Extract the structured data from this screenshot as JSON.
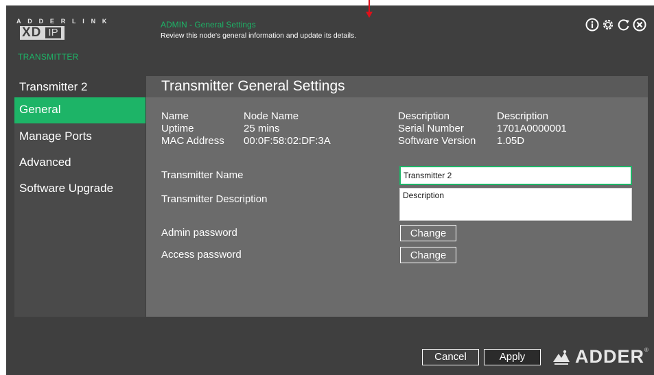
{
  "brand": {
    "letters": "ADDERLINK",
    "product_xd": "XD",
    "product_ip": "IP",
    "role": "TRANSMITTER"
  },
  "header": {
    "title": "ADMIN - General Settings",
    "subtitle": "Review this node's general information and update its details.",
    "icons": [
      "info-icon",
      "settings-gear-icon",
      "refresh-icon",
      "close-icon"
    ]
  },
  "sidebar": {
    "node_name": "Transmitter 2",
    "items": [
      {
        "label": "General",
        "active": true
      },
      {
        "label": "Manage Ports",
        "active": false
      },
      {
        "label": "Advanced",
        "active": false
      },
      {
        "label": "Software Upgrade",
        "active": false
      }
    ]
  },
  "main": {
    "title": "Transmitter General Settings",
    "info_left": [
      {
        "label": "Name",
        "value": "Node Name"
      },
      {
        "label": "Uptime",
        "value": "25 mins"
      },
      {
        "label": "MAC Address",
        "value": "00:0F:58:02:DF:3A"
      }
    ],
    "info_right": [
      {
        "label": "Description",
        "value": "Description"
      },
      {
        "label": "Serial Number",
        "value": "1701A0000001"
      },
      {
        "label": "Software Version",
        "value": "1.05D"
      }
    ],
    "fields": {
      "name_label": "Transmitter Name",
      "name_value": "Transmitter 2",
      "description_label": "Transmitter Description",
      "description_value": "Description",
      "admin_password_label": "Admin password",
      "access_password_label": "Access password",
      "change_label": "Change"
    }
  },
  "footer": {
    "cancel_label": "Cancel",
    "apply_label": "Apply",
    "logo_text": "ADDER",
    "logo_reg": "®"
  },
  "colors": {
    "accent": "#1db467",
    "background": "#3f3f3f",
    "panel": "#6b6b6b",
    "annotation_arrow": "#e0101a"
  }
}
